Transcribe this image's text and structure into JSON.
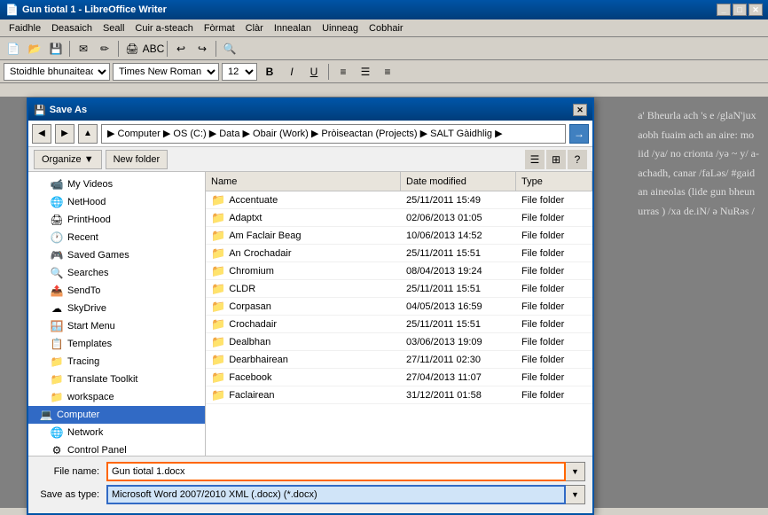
{
  "titleBar": {
    "title": "Gun tiotal 1 - LibreOffice Writer",
    "icon": "📄"
  },
  "menuBar": {
    "items": [
      "Faidhle",
      "Deasaich",
      "Seall",
      "Cuir a-steach",
      "Fòrmat",
      "Clàr",
      "Innealan",
      "Uinneag",
      "Cobhair"
    ]
  },
  "formatBar": {
    "style": "Stoidhle bhunaiteach",
    "font": "Times New Roman",
    "size": "12"
  },
  "dialog": {
    "title": "Save As",
    "addressPath": "▶ Computer ▶ OS (C:) ▶ Data ▶ Obair (Work) ▶ Pròiseactan (Projects) ▶ SALT Gàidhlig ▶",
    "organizeLabel": "Organize ▼",
    "newFolderLabel": "New folder",
    "columns": [
      "Name",
      "Date modified",
      "Type"
    ],
    "files": [
      {
        "name": "Accentuate",
        "date": "25/11/2011 15:49",
        "type": "File folder"
      },
      {
        "name": "Adaptxt",
        "date": "02/06/2013 01:05",
        "type": "File folder"
      },
      {
        "name": "Am Faclair Beag",
        "date": "10/06/2013 14:52",
        "type": "File folder"
      },
      {
        "name": "An Crochadair",
        "date": "25/11/2011 15:51",
        "type": "File folder"
      },
      {
        "name": "Chromium",
        "date": "08/04/2013 19:24",
        "type": "File folder"
      },
      {
        "name": "CLDR",
        "date": "25/11/2011 15:51",
        "type": "File folder"
      },
      {
        "name": "Corpasan",
        "date": "04/05/2013 16:59",
        "type": "File folder"
      },
      {
        "name": "Crochadair",
        "date": "25/11/2011 15:51",
        "type": "File folder"
      },
      {
        "name": "Dealbhan",
        "date": "03/06/2013 19:09",
        "type": "File folder"
      },
      {
        "name": "Dearbhairean",
        "date": "27/11/2011 02:30",
        "type": "File folder"
      },
      {
        "name": "Facebook",
        "date": "27/04/2013 11:07",
        "type": "File folder"
      },
      {
        "name": "Faclairean",
        "date": "31/12/2011 01:58",
        "type": "File folder"
      }
    ],
    "treeItems": [
      {
        "label": "My Videos",
        "icon": "📹",
        "indent": 1
      },
      {
        "label": "NetHood",
        "icon": "🌐",
        "indent": 1
      },
      {
        "label": "PrintHood",
        "icon": "🖨",
        "indent": 1
      },
      {
        "label": "Recent",
        "icon": "🕐",
        "indent": 1
      },
      {
        "label": "Saved Games",
        "icon": "🎮",
        "indent": 1
      },
      {
        "label": "Searches",
        "icon": "🔍",
        "indent": 1
      },
      {
        "label": "SendTo",
        "icon": "📤",
        "indent": 1
      },
      {
        "label": "SkyDrive",
        "icon": "☁",
        "indent": 1
      },
      {
        "label": "Start Menu",
        "icon": "🪟",
        "indent": 1
      },
      {
        "label": "Templates",
        "icon": "📋",
        "indent": 1
      },
      {
        "label": "Tracing",
        "icon": "📁",
        "indent": 1
      },
      {
        "label": "Translate Toolkit",
        "icon": "📁",
        "indent": 1
      },
      {
        "label": "workspace",
        "icon": "📁",
        "indent": 1
      },
      {
        "label": "Computer",
        "icon": "💻",
        "indent": 0,
        "selected": true
      },
      {
        "label": "Network",
        "icon": "🌐",
        "indent": 0
      },
      {
        "label": "Control Panel",
        "icon": "⚙",
        "indent": 0
      }
    ],
    "fileNameLabel": "File name:",
    "fileNameValue": "Gun tiotal 1.docx",
    "saveTypeLabel": "Save as type:",
    "saveTypeValue": "Microsoft Word 2007/2010 XML (.docx) (*.docx)"
  },
  "docText": [
    "a' Bheurla ach 's e /glaN'jux",
    "aobh fuaim ach an aire: mo",
    "iid /ya/ no crionta /yə ~ y/ a-",
    "achadh, canar /faLəs/ #gaid",
    "an aineolas (lide gun bheun",
    "urras ) /xa de.iN/ ə NuRəs /"
  ]
}
